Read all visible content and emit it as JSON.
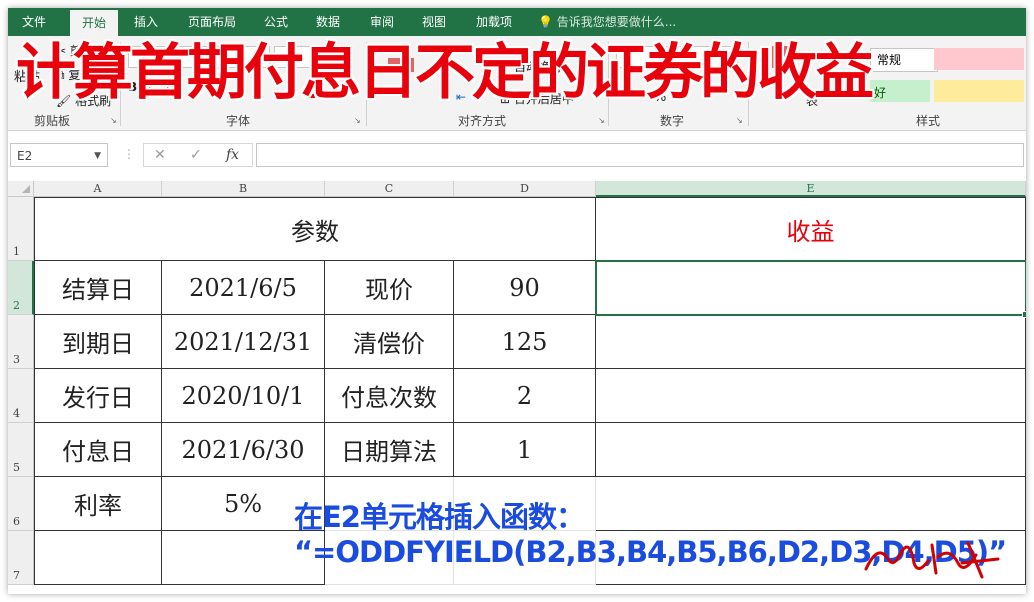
{
  "ribbon": {
    "tabs": [
      "文件",
      "开始",
      "插入",
      "页面布局",
      "公式",
      "数据",
      "审阅",
      "视图",
      "加载项"
    ],
    "active_tab": "开始",
    "tell_me": "告诉我您想要做什么...",
    "groups": [
      "剪贴板",
      "字体",
      "对齐方式",
      "数字",
      "样式"
    ],
    "clipboard_buttons": [
      "剪切",
      "复制",
      "格式刷"
    ],
    "paste_label": "粘贴",
    "wrap_text": "自动换行",
    "merge_center": "合并后居中",
    "number_format": "常规",
    "percent_sign": "%",
    "table_format": "表",
    "styles_label": "好"
  },
  "title_overlay": "计算首期付息日不定的证券的收益",
  "formula_bar": {
    "name_box": "E2",
    "cancel_icon": "✕",
    "enter_icon": "✓",
    "fx_label": "fx",
    "formula": ""
  },
  "sheet": {
    "columns": [
      "A",
      "B",
      "C",
      "D",
      "E"
    ],
    "selected_column": "E",
    "rows": [
      "1",
      "2",
      "3",
      "4",
      "5",
      "6",
      "7"
    ],
    "selected_row": "2",
    "header_params": "参数",
    "header_yield": "收益",
    "table": [
      [
        "结算日",
        "2021/6/5",
        "现价",
        "90"
      ],
      [
        "到期日",
        "2021/12/31",
        "清偿价",
        "125"
      ],
      [
        "发行日",
        "2020/10/1",
        "付息次数",
        "2"
      ],
      [
        "付息日",
        "2021/6/30",
        "日期算法",
        "1"
      ]
    ],
    "rate_label": "利率",
    "rate_value": "5%",
    "yield_color": "#e8000b"
  },
  "instruction": {
    "line1": "在E2单元格插入函数：",
    "line2": "“=ODDFYIELD(B2,B3,B4,B5,B6,D2,D3,D4,D5)”"
  },
  "colors": {
    "excel_green": "#217346",
    "title_red": "#e8000b",
    "instruction_blue": "#1b4ce0"
  }
}
